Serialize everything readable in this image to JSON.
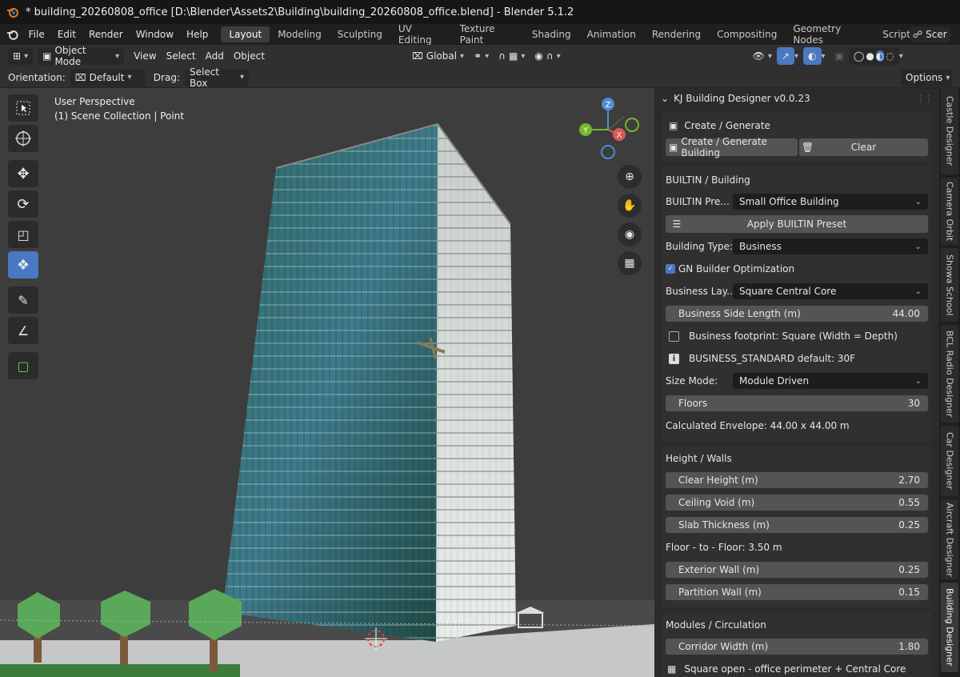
{
  "window_title": "* building_20260808_office [D:\\Blender\\Assets2\\Building\\building_20260808_office.blend] - Blender 5.1.2",
  "menu": [
    "File",
    "Edit",
    "Render",
    "Window",
    "Help"
  ],
  "workspaces": [
    "Layout",
    "Modeling",
    "Sculpting",
    "UV Editing",
    "Texture Paint",
    "Shading",
    "Animation",
    "Rendering",
    "Compositing",
    "Geometry Nodes",
    "Scripting"
  ],
  "scene_label": "Scer",
  "header": {
    "mode": "Object Mode",
    "view": "View",
    "select": "Select",
    "add": "Add",
    "object": "Object",
    "transform": "Global"
  },
  "tool_header": {
    "orientation_label": "Orientation:",
    "orientation_value": "Default",
    "drag_label": "Drag:",
    "drag_value": "Select Box",
    "options": "Options"
  },
  "viewport": {
    "perspective": "User Perspective",
    "collection": "(1) Scene Collection | Point"
  },
  "gizmo_axes": [
    "Z",
    "Y",
    "X"
  ],
  "panel": {
    "title": "KJ Building Designer v0.0.23",
    "create_section": "Create / Generate",
    "create_button": "Create / Generate Building",
    "clear_button": "Clear",
    "builtin_section": "BUILTIN / Building",
    "builtin_preset_label": "BUILTIN Pre...",
    "builtin_preset_value": "Small Office Building",
    "apply_preset": "Apply BUILTIN Preset",
    "building_type_label": "Building Type:",
    "building_type_value": "Business",
    "gn_opt": "GN Builder Optimization",
    "layout_label": "Business Lay...",
    "layout_value": "Square Central Core",
    "side_length_label": "Business Side Length (m)",
    "side_length_value": "44.00",
    "footprint": "Business footprint: Square (Width = Depth)",
    "default_info": "BUSINESS_STANDARD default: 30F",
    "size_mode_label": "Size Mode:",
    "size_mode_value": "Module Driven",
    "floors_label": "Floors",
    "floors_value": "30",
    "envelope": "Calculated Envelope: 44.00 x 44.00 m",
    "height_section": "Height / Walls",
    "clear_height_label": "Clear Height (m)",
    "clear_height_value": "2.70",
    "ceiling_void_label": "Ceiling Void (m)",
    "ceiling_void_value": "0.55",
    "slab_label": "Slab Thickness (m)",
    "slab_value": "0.25",
    "floor_to_floor": "Floor - to - Floor: 3.50 m",
    "ext_wall_label": "Exterior Wall (m)",
    "ext_wall_value": "0.25",
    "partition_label": "Partition Wall (m)",
    "partition_value": "0.15",
    "modules_section": "Modules / Circulation",
    "corridor_label": "Corridor Width (m)",
    "corridor_value": "1.80",
    "perimeter_info": "Square open - office perimeter + Central Core"
  },
  "side_tabs": [
    "Castle Designer",
    "Camera Orbit",
    "Showa School",
    "BCL Radio Designer",
    "Car Designer",
    "Aircraft Designer",
    "Building Designer"
  ],
  "colors": {
    "accent": "#4a78c2",
    "axis_x": "#e05555",
    "axis_y": "#76b82a",
    "axis_z": "#4f8cd6"
  }
}
